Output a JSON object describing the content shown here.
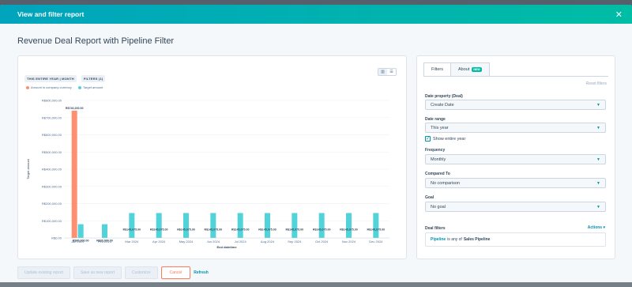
{
  "modal": {
    "title": "View and filter report",
    "close_icon": "close-icon"
  },
  "report_title": "Revenue Deal Report with Pipeline Filter",
  "chart_tags": [
    "THIS ENTIRE YEAR | MONTH",
    "FILTERS (1)"
  ],
  "legend": [
    {
      "label": "Amount in company currency",
      "color": "#ff8f73"
    },
    {
      "label": "Target amount",
      "color": "#51d3d9"
    }
  ],
  "chart_data": {
    "type": "bar",
    "xlabel": "End datetime",
    "ylabel": "Target amount",
    "ylim": [
      0,
      800000
    ],
    "yticks": [
      "R$0.00",
      "R$100,000.00",
      "R$200,000.00",
      "R$300,000.00",
      "R$400,000.00",
      "R$500,000.00",
      "R$600,000.00",
      "R$700,000.00",
      "R$800,000.00"
    ],
    "categories": [
      "Jan 2024",
      "Feb 2024",
      "Mar 2024",
      "Apr 2024",
      "May 2024",
      "Jun 2024",
      "Jul 2024",
      "Aug 2024",
      "Sep 2024",
      "Oct 2024",
      "Nov 2024",
      "Dec 2024"
    ],
    "series": [
      {
        "name": "Amount in company currency",
        "color": "#ff8f73",
        "values": [
          740200,
          null,
          null,
          null,
          null,
          null,
          null,
          null,
          null,
          null,
          null,
          null
        ],
        "labels": [
          "R$740,200.00",
          "",
          "",
          "",
          "",
          "",
          "",
          "",
          "",
          "",
          "",
          ""
        ]
      },
      {
        "name": "Target amount",
        "color": "#51d3d9",
        "values": [
          80000,
          80000,
          145075,
          145075,
          145075,
          145075,
          145075,
          145075,
          145075,
          145075,
          145075,
          145075
        ],
        "labels": [
          "R$80,000.00",
          "R$80,000.00",
          "R$145,075.00",
          "R$145,075.00",
          "R$145,075.00",
          "R$145,075.00",
          "R$145,075.00",
          "R$145,075.00",
          "R$145,075.00",
          "R$145,075.00",
          "R$145,075.00",
          "R$145,075.00"
        ]
      }
    ]
  },
  "filters": {
    "tabs": [
      {
        "label": "Filters"
      },
      {
        "label": "About",
        "badge": "NEW"
      }
    ],
    "reset_label": "Reset filters",
    "date_property": {
      "label": "Date property (Deal)",
      "value": "Create Date"
    },
    "date_range": {
      "label": "Date range",
      "value": "This year"
    },
    "show_entire_year": {
      "label": "Show entire year",
      "checked": true
    },
    "frequency": {
      "label": "Frequency",
      "value": "Monthly"
    },
    "compared_to": {
      "label": "Compared To",
      "value": "No comparison"
    },
    "goal": {
      "label": "Goal",
      "value": "No goal"
    },
    "deal_filters": {
      "label": "Deal filters",
      "actions": "Actions",
      "rule": {
        "property": "Pipeline",
        "operator": "is any of",
        "value": "Sales Pipeline"
      }
    }
  },
  "footer": {
    "update_label": "Update existing report",
    "save_new_label": "Save as new report",
    "customize_label": "Customize",
    "cancel_label": "Cancel",
    "refresh_label": "Refresh"
  }
}
